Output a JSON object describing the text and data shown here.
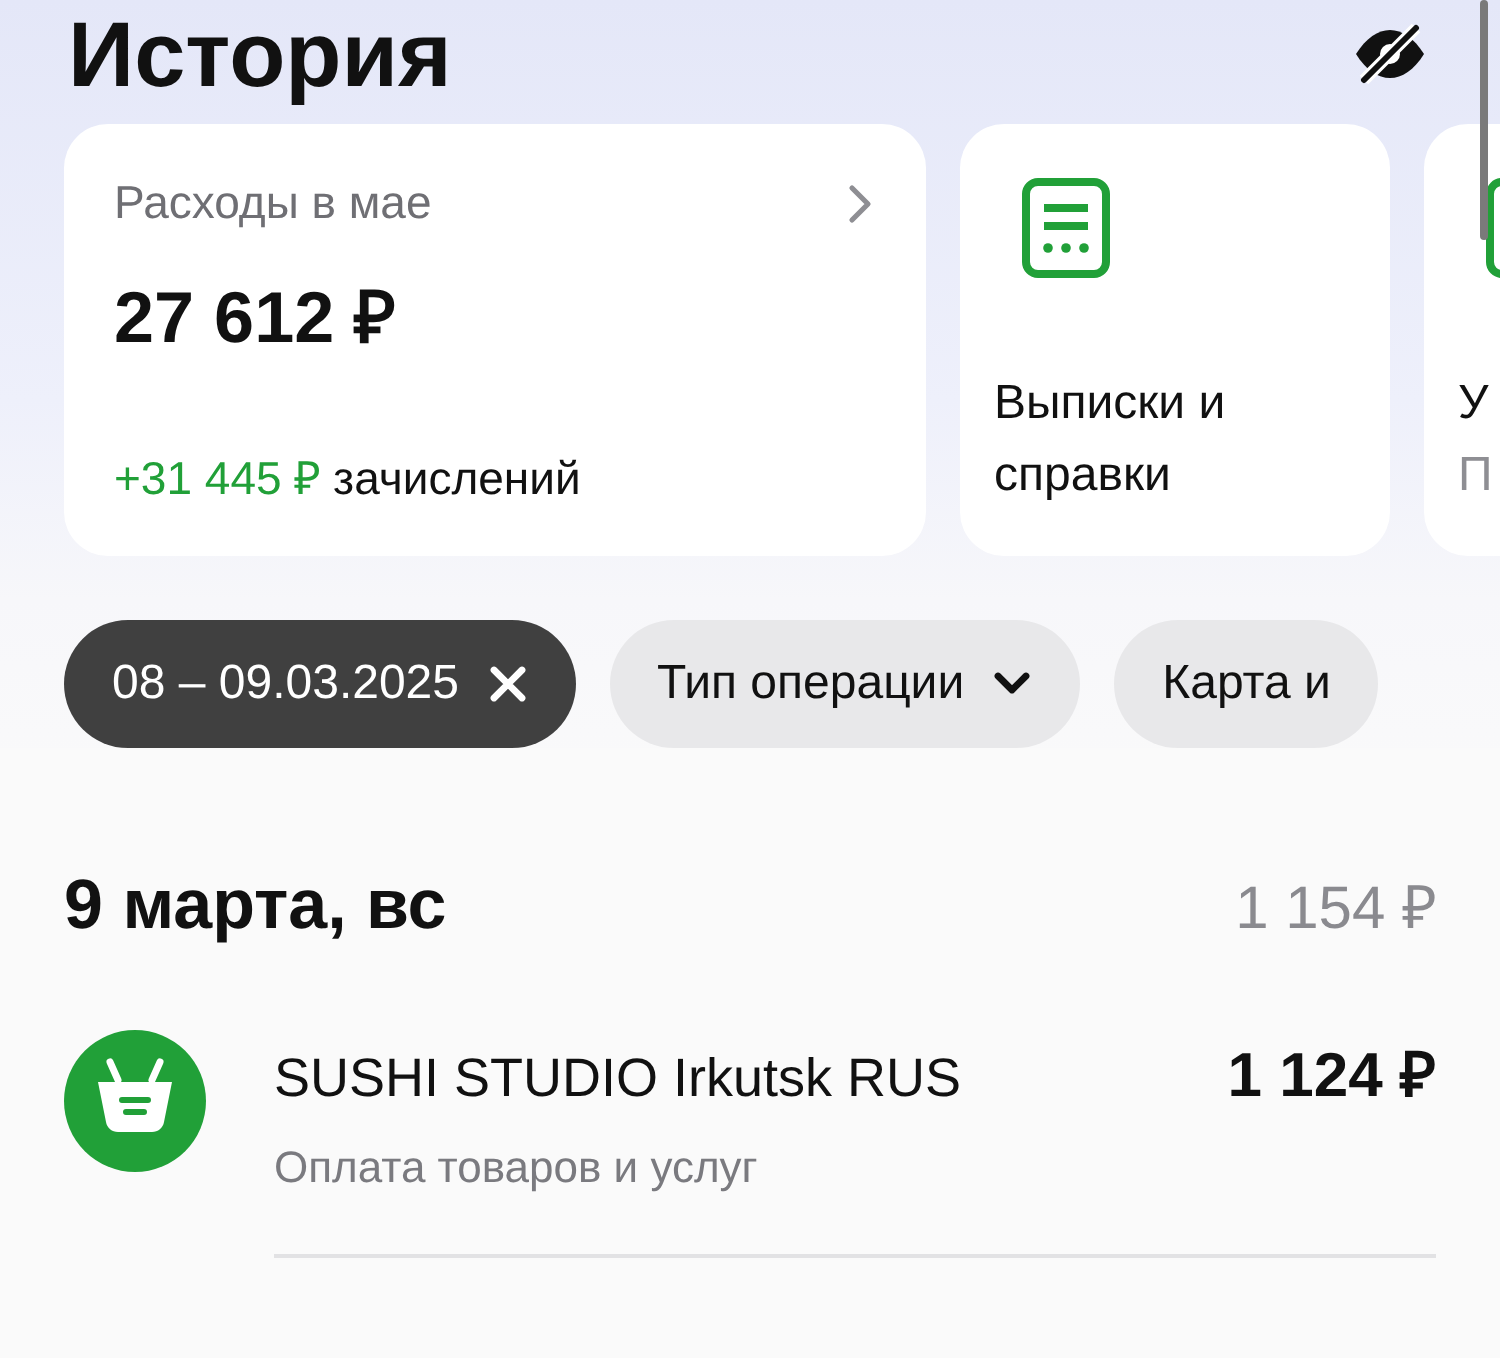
{
  "title": "История",
  "cards": [
    {
      "kind": "summary",
      "title": "Расходы в мае",
      "amount": "27 612 ₽",
      "income": "+31 445 ₽",
      "income_label": "зачислений"
    },
    {
      "kind": "action",
      "title": "Выписки и справки"
    },
    {
      "kind": "action",
      "title": "У",
      "subtitle": "П"
    }
  ],
  "filters": [
    {
      "label": "08 – 09.03.2025",
      "selected": true,
      "kind": "clear"
    },
    {
      "label": "Тип операции",
      "selected": false,
      "kind": "dropdown"
    },
    {
      "label": "Карта и",
      "selected": false,
      "kind": "plain"
    }
  ],
  "days": [
    {
      "date": "9 марта, вс",
      "total": "1 154 ₽",
      "operations": [
        {
          "name": "SUSHI STUDIO Irkutsk RUS",
          "category": "Оплата товаров и услуг",
          "amount": "1 124 ₽"
        }
      ]
    }
  ]
}
